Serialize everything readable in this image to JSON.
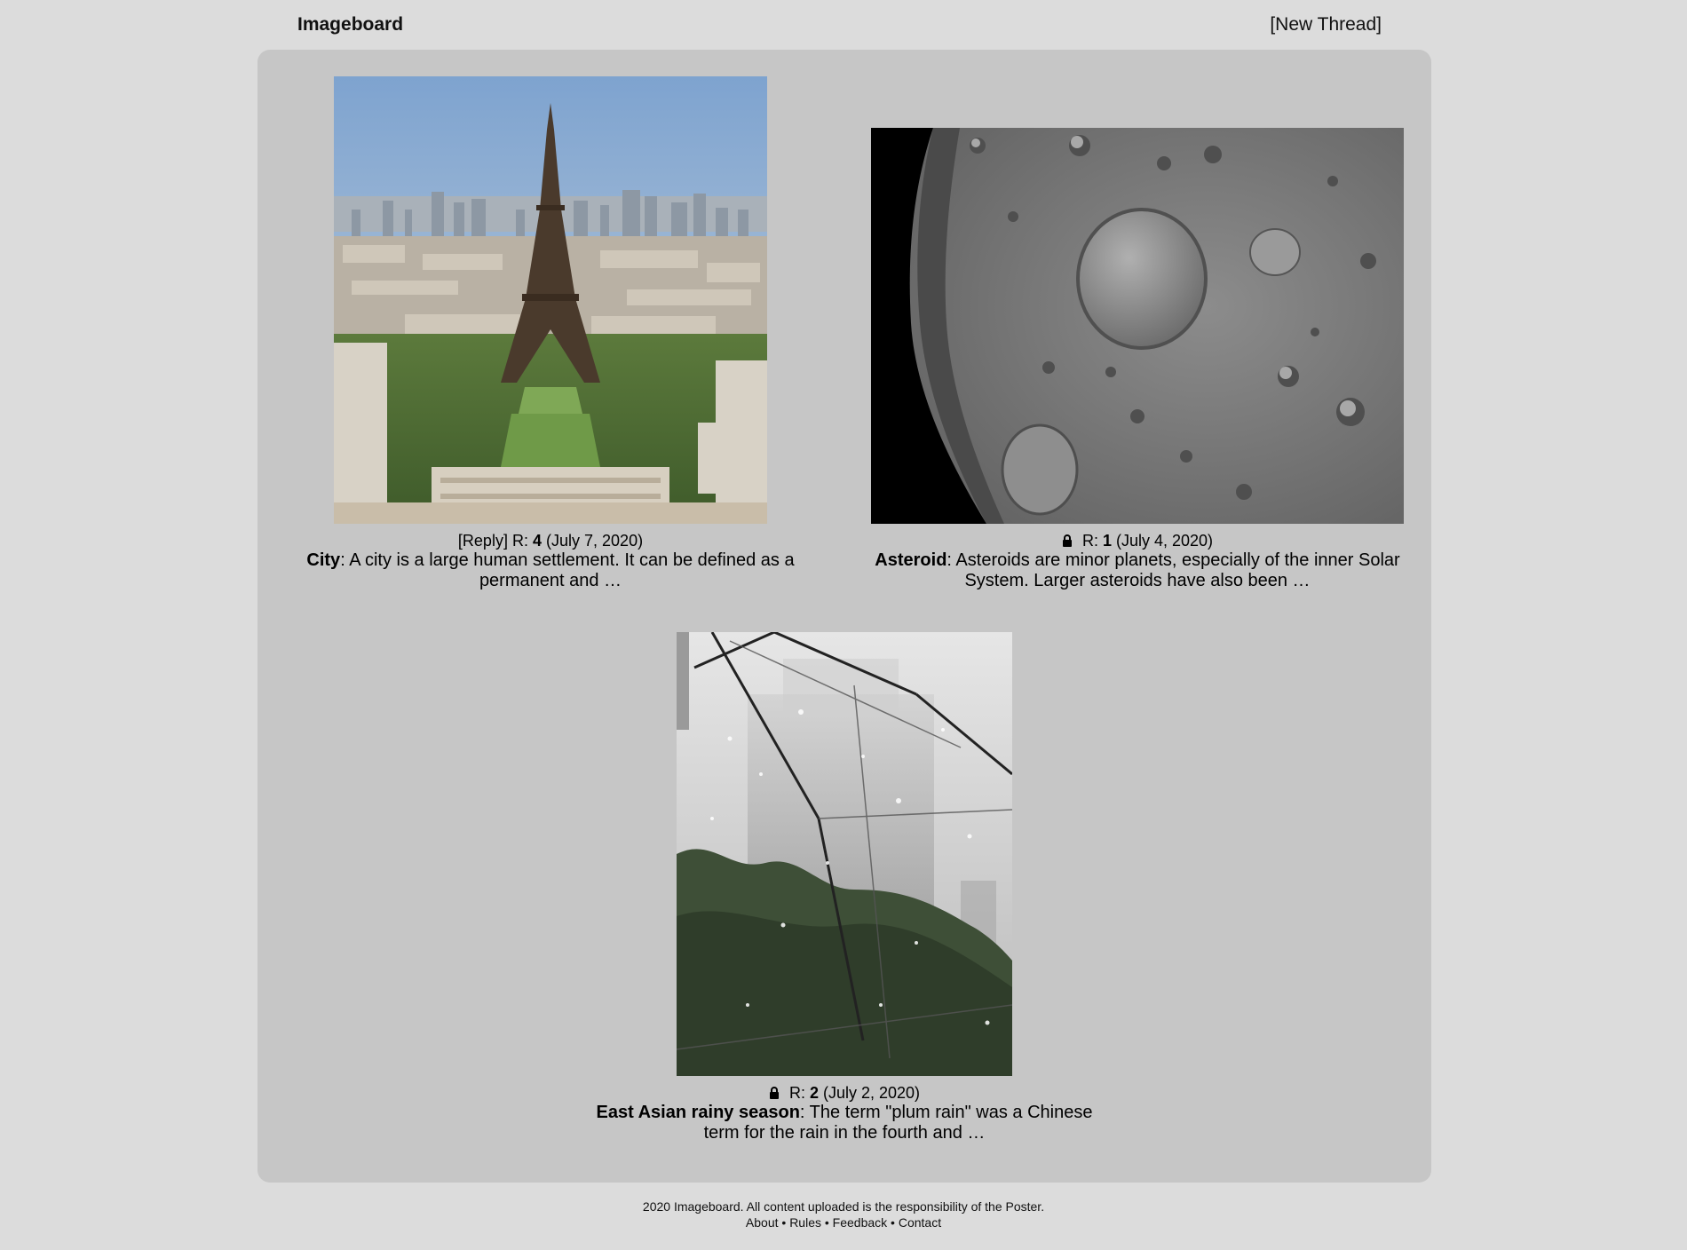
{
  "header": {
    "title": "Imageboard",
    "new_thread_label": "[New Thread]"
  },
  "threads": [
    {
      "reply_label": "[Reply]",
      "replies_prefix": "R:",
      "replies": "4",
      "date": "(July 7, 2020)",
      "title": "City",
      "excerpt": ": A city is a large human settlement. It can be defined as a permanent and …",
      "locked": false,
      "image": "eiffel-tower-city-photo"
    },
    {
      "reply_label": "",
      "replies_prefix": "R:",
      "replies": "1",
      "date": "(July 4, 2020)",
      "title": "Asteroid",
      "excerpt": ": Asteroids are minor planets, especially of the inner Solar System. Larger asteroids have also been …",
      "locked": true,
      "image": "asteroid-surface-photo"
    },
    {
      "reply_label": "",
      "replies_prefix": "R:",
      "replies": "2",
      "date": "(July 2, 2020)",
      "title": "East Asian rainy season",
      "excerpt": ": The term \"plum rain\" was a Chinese term for the rain in the fourth and …",
      "locked": true,
      "image": "rain-umbrella-photo"
    }
  ],
  "footer": {
    "copyright": "2020 Imageboard. All content uploaded is the responsibility of the Poster.",
    "links": [
      "About",
      "Rules",
      "Feedback",
      "Contact"
    ],
    "separator": " • "
  },
  "colors": {
    "page_bg": "#dcdcdc",
    "board_bg": "#c6c6c6"
  }
}
